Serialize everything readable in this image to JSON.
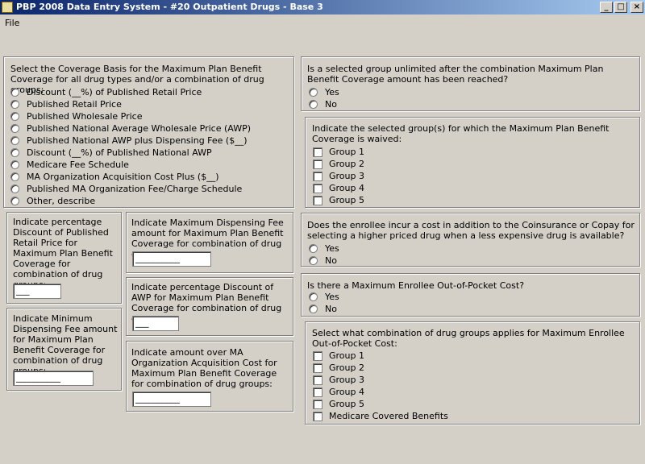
{
  "window": {
    "title": "PBP 2008 Data Entry System - #20 Outpatient Drugs - Base 3",
    "minimize": "_",
    "maximize": "□",
    "close": "×"
  },
  "menu": {
    "file": "File"
  },
  "coverage_basis": {
    "question": "Select the Coverage Basis for the Maximum Plan Benefit Coverage for all drug types and/or a combination of drug groups:",
    "options": [
      "Discount (__%) of Published Retail Price",
      "Published Retail Price",
      "Published Wholesale Price",
      "Published National Average Wholesale Price (AWP)",
      "Published National AWP plus Dispensing Fee ($__)",
      "Discount (__%) of Published National AWP",
      "Medicare Fee Schedule",
      "MA Organization Acquisition Cost Plus ($__)",
      "Published MA Organization Fee/Charge Schedule",
      "Other, describe"
    ]
  },
  "pct_retail": {
    "label": "Indicate percentage Discount of Published Retail Price for Maximum Plan Benefit Coverage for combination of drug groups:",
    "value": "___"
  },
  "min_dispensing": {
    "label": "Indicate Minimum Dispensing Fee amount for Maximum Plan Benefit Coverage for combination of drug groups:",
    "value": "__________"
  },
  "max_dispensing": {
    "label": "Indicate Maximum Dispensing Fee amount for Maximum Plan Benefit Coverage for combination of drug groups:",
    "value": "__________"
  },
  "pct_awp": {
    "label": "Indicate percentage Discount of AWP for Maximum Plan Benefit Coverage for combination of drug groups:",
    "value": "___"
  },
  "amount_ma": {
    "label": "Indicate amount over MA Organization Acquisition Cost for Maximum Plan Benefit Coverage for combination of drug groups:",
    "value": "__________"
  },
  "unlimited": {
    "question": "Is a selected group unlimited after the combination Maximum Plan Benefit Coverage amount has been reached?",
    "yes": "Yes",
    "no": "No"
  },
  "waived": {
    "question": "Indicate the selected group(s) for which the Maximum Plan Benefit Coverage is waived:",
    "groups": [
      "Group 1",
      "Group 2",
      "Group 3",
      "Group 4",
      "Group 5"
    ]
  },
  "additional_cost": {
    "question": "Does the enrollee incur a cost in addition to the Coinsurance or Copay for selecting a higher priced drug when a less expensive drug is available?",
    "yes": "Yes",
    "no": "No"
  },
  "max_oop": {
    "question": "Is there a Maximum Enrollee Out-of-Pocket Cost?",
    "yes": "Yes",
    "no": "No"
  },
  "oop_groups": {
    "question": "Select what combination of drug groups applies for Maximum Enrollee Out-of-Pocket Cost:",
    "groups": [
      "Group 1",
      "Group 2",
      "Group 3",
      "Group 4",
      "Group 5",
      "Medicare Covered Benefits"
    ]
  }
}
